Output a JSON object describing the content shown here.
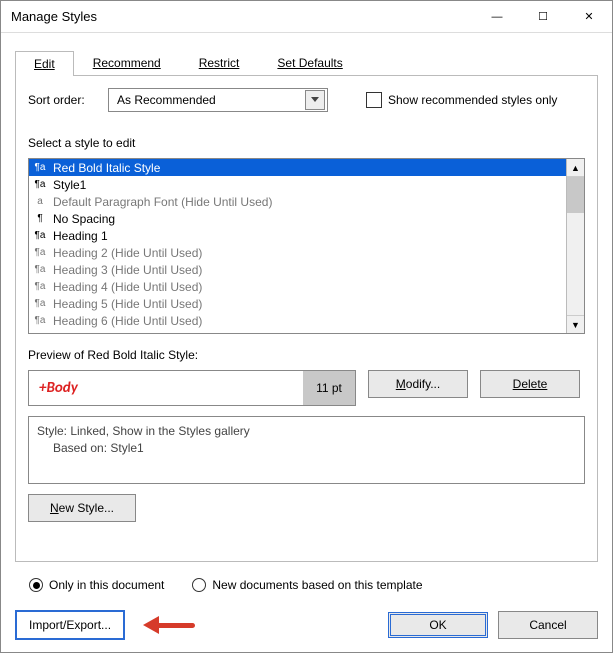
{
  "window": {
    "title": "Manage Styles"
  },
  "tabs": {
    "edit": "Edit",
    "recommend": "Recommend",
    "restrict": "Restrict",
    "setdefaults": "Set Defaults"
  },
  "sort": {
    "label": "Sort order:",
    "value": "As Recommended",
    "show_recommended": "Show recommended styles only"
  },
  "list": {
    "prompt": "Select a style to edit",
    "items": [
      {
        "name": "Red Bold Italic Style",
        "enabled": true,
        "selected": true,
        "sym": "¶a"
      },
      {
        "name": "Style1",
        "enabled": true,
        "sym": "¶a"
      },
      {
        "name": "Default Paragraph Font  (Hide Until Used)",
        "enabled": false,
        "sym": "a"
      },
      {
        "name": "No Spacing",
        "enabled": true,
        "sym": "¶"
      },
      {
        "name": "Heading 1",
        "enabled": true,
        "sym": "¶a"
      },
      {
        "name": "Heading 2  (Hide Until Used)",
        "enabled": false,
        "sym": "¶a"
      },
      {
        "name": "Heading 3  (Hide Until Used)",
        "enabled": false,
        "sym": "¶a"
      },
      {
        "name": "Heading 4  (Hide Until Used)",
        "enabled": false,
        "sym": "¶a"
      },
      {
        "name": "Heading 5  (Hide Until Used)",
        "enabled": false,
        "sym": "¶a"
      },
      {
        "name": "Heading 6  (Hide Until Used)",
        "enabled": false,
        "sym": "¶a"
      }
    ]
  },
  "preview": {
    "label": "Preview of Red Bold Italic Style:",
    "sample": "+Body",
    "size": "11 pt"
  },
  "buttons": {
    "modify": "Modify...",
    "delete": "Delete",
    "newstyle": "New Style...",
    "importexport": "Import/Export...",
    "ok": "OK",
    "cancel": "Cancel"
  },
  "desc": {
    "line1": "Style: Linked, Show in the Styles gallery",
    "line2": "Based on: Style1"
  },
  "scope": {
    "only": "Only in this document",
    "new": "New documents based on this template"
  }
}
